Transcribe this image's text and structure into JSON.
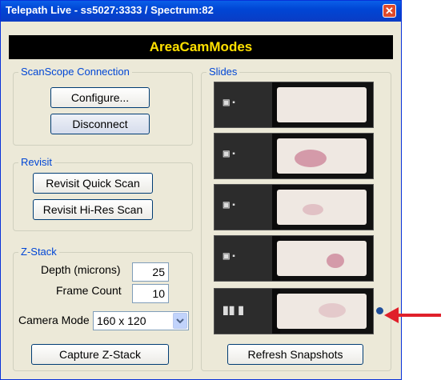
{
  "window": {
    "title": "Telepath Live  - ss5027:3333 / Spectrum:82",
    "close_glyph": "✕"
  },
  "mode_banner": "AreaCamModes",
  "scanscope": {
    "legend": "ScanScope Connection",
    "configure_label": "Configure...",
    "disconnect_label": "Disconnect"
  },
  "revisit": {
    "legend": "Revisit",
    "quick_label": "Revisit Quick Scan",
    "hires_label": "Revisit Hi-Res Scan"
  },
  "zstack": {
    "legend": "Z-Stack",
    "depth_label": "Depth (microns)",
    "depth_value": "25",
    "frame_label": "Frame Count",
    "frame_value": "10",
    "camera_label": "Camera Mode",
    "camera_value": "160 x 120",
    "capture_label": "Capture Z-Stack"
  },
  "slides": {
    "legend": "Slides",
    "refresh_label": "Refresh Snapshots",
    "count": 5
  },
  "colors": {
    "banner_text": "#ffe000",
    "titlebar": "#0046d5",
    "arrow": "#e0202a",
    "selected_dot": "#1f4e9a"
  }
}
